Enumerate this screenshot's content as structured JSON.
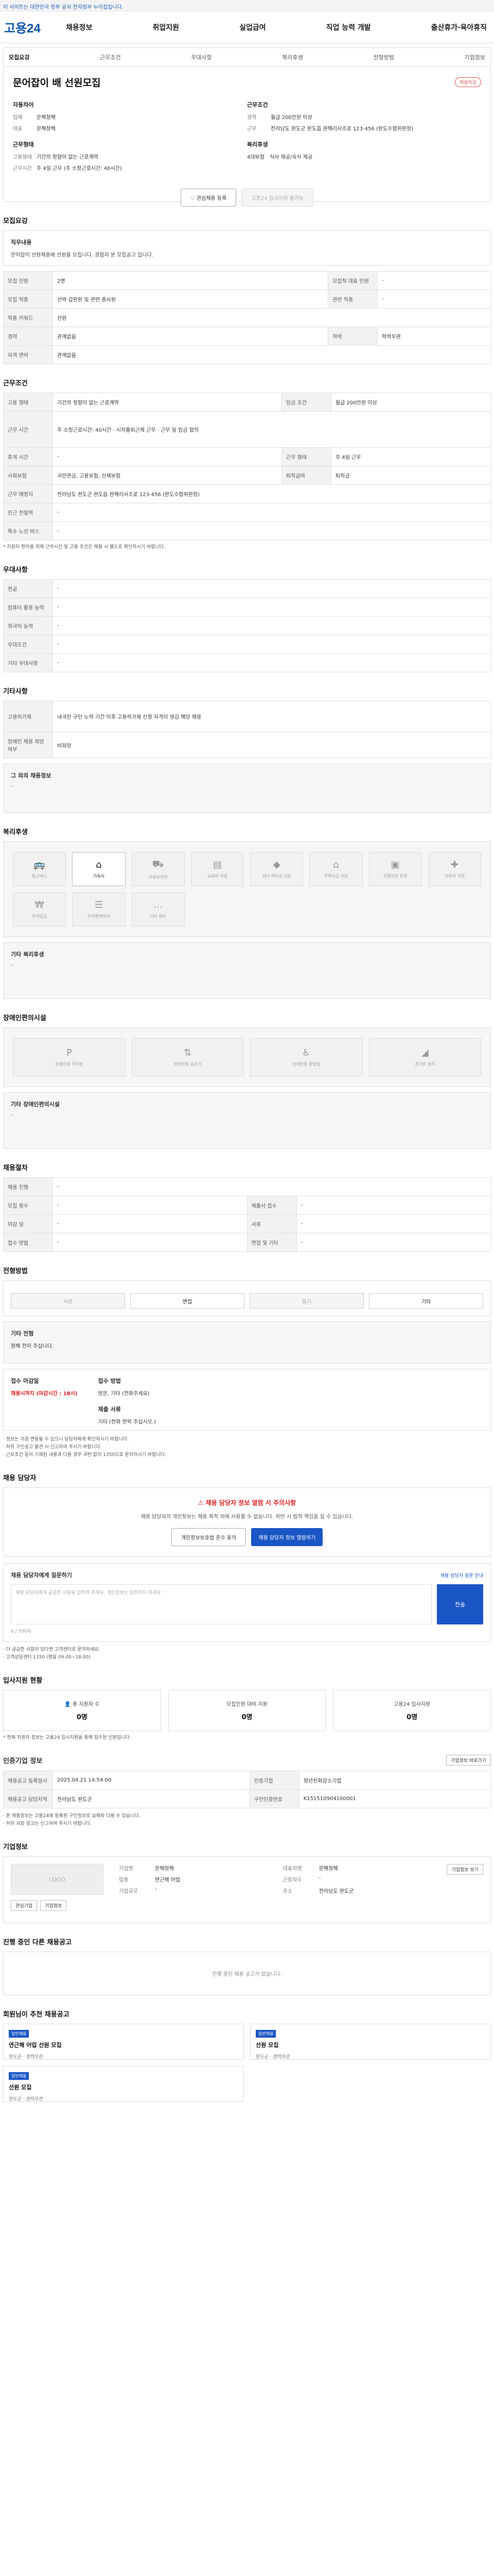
{
  "topbar": {
    "text": "이 사이트는 대한민국 정부 공식 전자정부 누리집입니다."
  },
  "header": {
    "logo": "고용24",
    "nav": [
      "채용정보",
      "취업지원",
      "실업급여",
      "직업 능력 개발",
      "출산휴가·육아휴직"
    ]
  },
  "job": {
    "tabs": [
      "모집요강",
      "근무조건",
      "우대사항",
      "복리후생",
      "전형방법",
      "기업정보"
    ],
    "title": "문어잡이 배 선원모집",
    "badge": "채용마감",
    "company_head": "자동차어",
    "recruit_head": "근무조건",
    "company": [
      {
        "k": "업체",
        "v": "문해청해"
      },
      {
        "k": "대표",
        "v": "문해청해"
      }
    ],
    "recruit": [
      {
        "k": "경력",
        "v": "월급 200만원 이상"
      },
      {
        "k": "근무",
        "v": "전라남도 완도군 완도읍 완해리사조로 123-456 (완도수협위판장)"
      }
    ],
    "cond_head": "근무형태",
    "pay_head": "복리후생",
    "cond": [
      {
        "k": "고용형태",
        "v": "기간의 정함이 없는 근로계약"
      },
      {
        "k": "근무시간",
        "v": "주 4일 근무 (주 소정근로시간: 40시간)"
      }
    ],
    "pay": [
      {
        "k": "",
        "v": "4대보험",
        "v2": "식사 제공/숙식 제공"
      }
    ],
    "btn_fav": "관심채용 등록",
    "btn_apply": "고용24 입사지원 불가능"
  },
  "s1": {
    "title": "모집요강",
    "box_head": "직무내용",
    "box_text": "문어잡이 선원채용에 선원을 모집니다. 경험자 분 모집공고 입니다.",
    "rows": [
      [
        "모집 인원",
        "2명",
        "모집직 대표 인원",
        "-"
      ],
      [
        "모집 직종",
        "선박 갑판원 및 관련 종사원",
        "관련 직종",
        "-"
      ],
      [
        "직종 키워드",
        "선원",
        "",
        ""
      ],
      [
        "경력",
        "관계없음",
        "학력",
        "학력무관"
      ],
      [
        "자격 면허",
        "관계없음",
        "",
        ""
      ]
    ]
  },
  "s2": {
    "title": "근무조건",
    "rows": [
      [
        "고용 형태",
        "기간의 정함이 없는 근로계약",
        "임금 조건",
        "월급 200만원 이상"
      ],
      [
        "근무 시간",
        "주 소정근로시간: 40시간 · 시차출퇴근제 근무 · 근무 일 임금 협의",
        "",
        ""
      ],
      [
        "휴게 시간",
        "-",
        "근무 형태",
        "주 4일 근무"
      ],
      [
        "사회보험",
        "국민연금, 고용보험, 산재보험",
        "퇴직급여",
        "퇴직금"
      ],
      [
        "근무 예정지",
        "전라남도 완도군 완도읍 완해리사조로 123-456 (완도수협위판장)",
        "",
        ""
      ],
      [
        "인근 전철역",
        "-",
        "",
        ""
      ],
      [
        "특수 노선 버스",
        "-",
        "",
        ""
      ]
    ],
    "note": "* 지원자 편의를 위해 근무시간 및 고용 조건은 채용 시 별도로 확인하시기 바랍니다."
  },
  "s3": {
    "title": "우대사항",
    "rows": [
      [
        "전공",
        "-"
      ],
      [
        "컴퓨터 활용 능력",
        "-"
      ],
      [
        "외국어 능력",
        "-"
      ],
      [
        "우대조건",
        "-"
      ],
      [
        "기타 우대사항",
        "-"
      ]
    ]
  },
  "s4": {
    "title": "기타사항",
    "rows": [
      [
        "고용허가제",
        "내국인 구인 노력 기간 이후 고용허가제 신청 자격이 생김 해당 채용"
      ],
      [
        "장애인 채용 희망 여부",
        "비희망"
      ]
    ],
    "sub_head": "그 외의 채용정보",
    "sub_text": "-"
  },
  "s5": {
    "title": "복리후생",
    "items": [
      "통근버스",
      "기숙사",
      "차량유지비",
      "교육비 지원",
      "자녀 학자금 지원",
      "주택자금 지원",
      "차량지원 운영",
      "의료비 지원",
      "우대임금",
      "우대정책복리",
      "기타 제도"
    ],
    "other_head": "기타 복리후생",
    "other_text": "-"
  },
  "s6": {
    "title": "장애인편의시설",
    "items": [
      "장애인용 주차장",
      "장애인용 승강기",
      "장애인용 화장실",
      "경사로 설치"
    ],
    "other_head": "기타 장애인편의시설",
    "other_text": "-"
  },
  "s7": {
    "title": "채용절차",
    "rows": [
      [
        "채용 진행",
        "-",
        "",
        ""
      ],
      [
        "모집 횟수",
        "-",
        "제출서 접수",
        "-"
      ],
      [
        "마감 일",
        "-",
        "서류",
        "-"
      ],
      [
        "접수 방법",
        "-",
        "면접 및 기타",
        "-"
      ]
    ]
  },
  "s8": {
    "title": "전형방법",
    "steps": [
      "서류",
      "면접",
      "필기",
      "기타"
    ],
    "exam_head": "기타 전형",
    "exam_text": "정해 전이 주십니다.",
    "apply_head": "접수 마감일",
    "apply_val": "채용시까지 (마감시간 : 18시)",
    "docs_head": "접수 방법",
    "docs_text": "방문, 기타 (전화주세요)",
    "docs2_head": "제출 서류",
    "docs2_text": "기타 (전화 연락 주십시오.)",
    "bullets": [
      "· 정보는 가끔 변동될 수 있으니 담당자에게 확인하시기 바랍니다.",
      "· 허위 구인공고 발견 시 신고하여 주시기 바랍니다.",
      "· 근로조건 등이 기재된 내용과 다를 경우 국번 없이 1350으로 문의하시기 바랍니다."
    ]
  },
  "s9": {
    "title": "채용 담당자",
    "warn": "채용 담당자 정보 열람 시 주의사항",
    "warn_text": "채용 담당자의 개인정보는 채용 목적 외에 사용할 수 없습니다. 위반 시 법적 책임을 질 수 있습니다.",
    "btn_agree": "개인정보보호법 준수 동의",
    "btn_view": "채용 담당자 정보 열람하기",
    "q_head": "채용 담당자에게 질문하기",
    "q_link": "채용 담당자 질문 안내",
    "q_placeholder": "채용 담당자에게 궁금한 사항을 입력해 주세요. 개인정보는 입력하지 마세요.",
    "q_count": "0 / 500자",
    "q_btn": "전송",
    "bullets": [
      "· 더 궁금한 사항이 있다면 고객센터로 문의하세요.",
      "· 고객상담센터 1350 (평일 09:00~18:00)"
    ]
  },
  "s10": {
    "title": "입사지원 현황",
    "stats": [
      {
        "t": "총 지원자 수",
        "v": "0명"
      },
      {
        "t": "모집인원 대비 지원",
        "v": "0명"
      },
      {
        "t": "고용24 입사지원",
        "v": "0명"
      }
    ],
    "note": "* 현재 지원자 정보는 고용24 입사지원을 통해 접수된 인원입니다."
  },
  "s11": {
    "title": "인증기업 정보",
    "btn": "기업정보 바로가기",
    "rows": [
      [
        "채용공고 등록일시",
        "2025.04.21 14:54:00",
        "인증기업",
        "청년친화강소기업"
      ],
      [
        "채용공고 담당지역",
        "전라남도 완도군",
        "구인인증번호",
        "K151510904100001"
      ]
    ],
    "bullets": [
      "· 본 채용정보는 고용24에 등록된 구인정보로 실제와 다를 수 있습니다.",
      "· 허위 과장 광고는 신고하여 주시기 바랍니다."
    ]
  },
  "s12": {
    "title": "기업정보",
    "logo_text": "LOGO",
    "btn": "기업정보 보기",
    "rows": [
      [
        "기업명",
        "문해청해"
      ],
      [
        "업종",
        "연근해 어업"
      ],
      [
        "기업규모",
        "-"
      ]
    ],
    "rows2": [
      [
        "대표자명",
        "문해청해"
      ],
      [
        "근로자수",
        "-"
      ],
      [
        "주소",
        "전라남도 완도군"
      ]
    ],
    "btn_a": "관심기업",
    "btn_b": "기업정보"
  },
  "s13": {
    "title": "진행 중인 다른 채용공고",
    "empty": "진행 중인 채용 공고가 없습니다."
  },
  "s14": {
    "title": "회원님이 추천 채용공고",
    "cards": [
      {
        "tag": "일반채용",
        "ttl": "연근해 어업 선원 모집",
        "meta": "완도군 · 경력무관"
      },
      {
        "tag": "일반채용",
        "ttl": "선원 모집",
        "meta": "완도군 · 경력무관"
      },
      {
        "tag": "일반채용",
        "ttl": "선원 모집",
        "meta": "완도군 · 경력무관"
      }
    ]
  }
}
